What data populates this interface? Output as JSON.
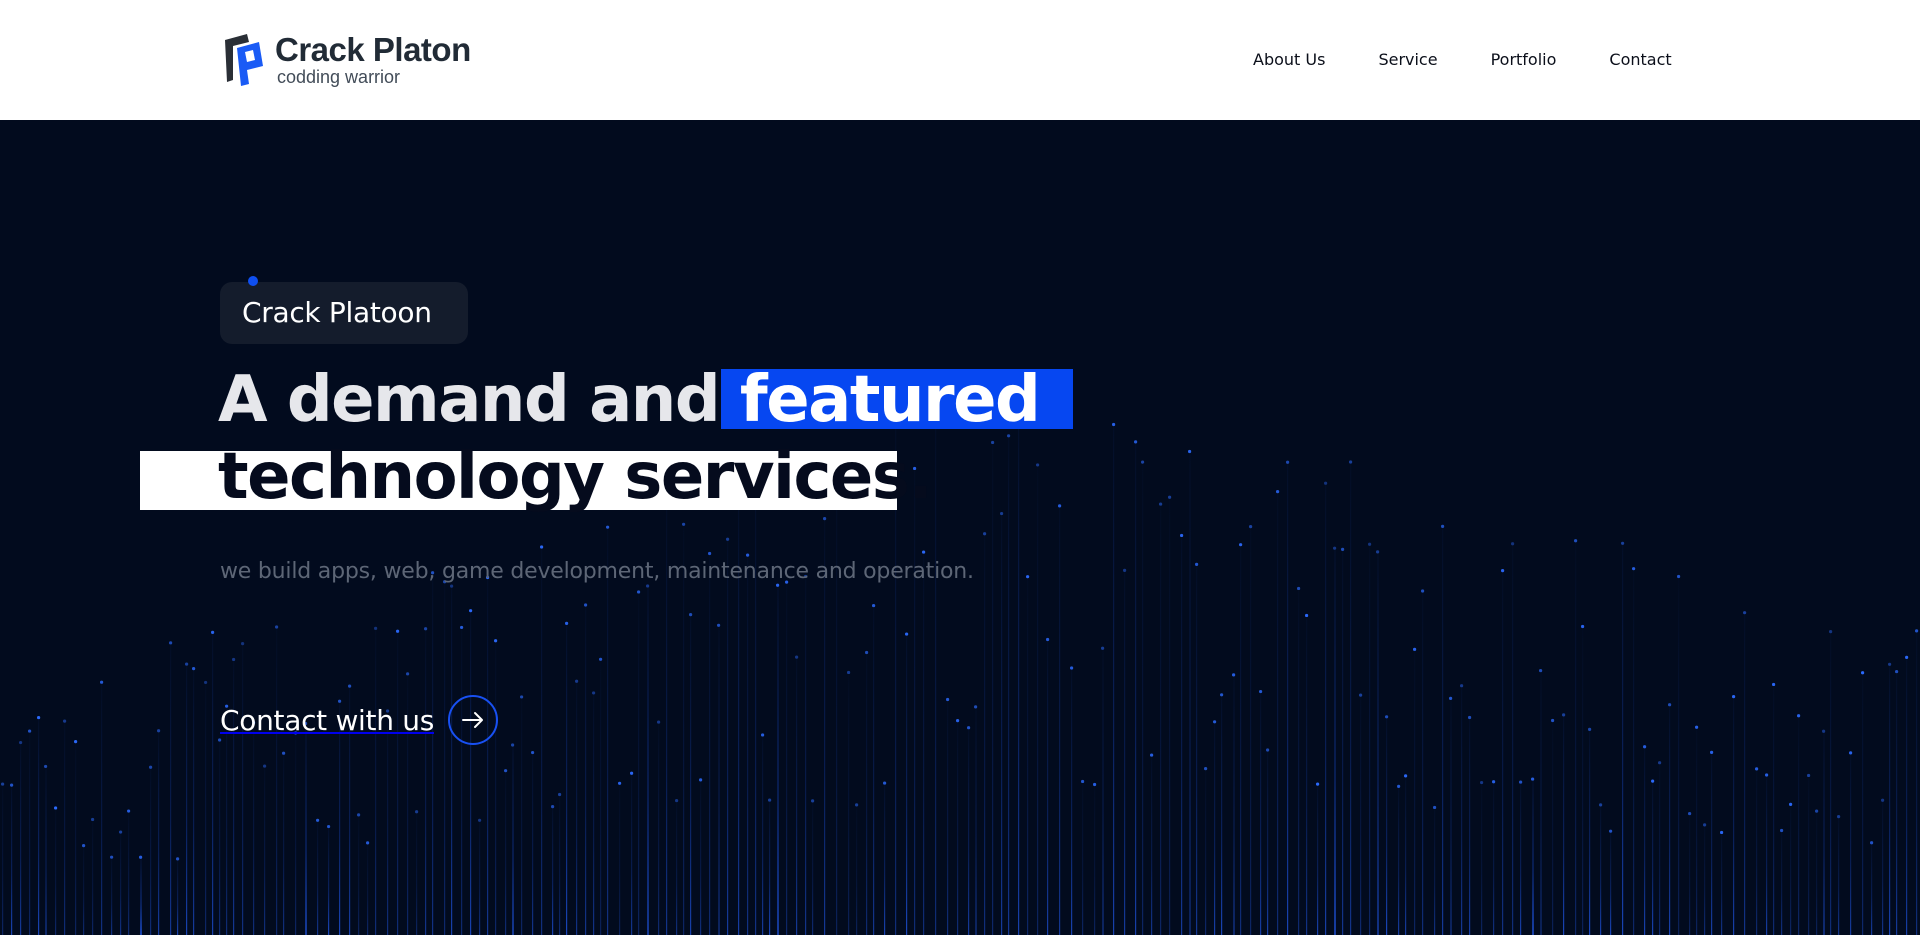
{
  "header": {
    "brand_name": "Crack Platon",
    "brand_tagline": "codding warrior",
    "nav": [
      {
        "label": "About Us"
      },
      {
        "label": "Service"
      },
      {
        "label": "Portfolio"
      },
      {
        "label": "Contact"
      }
    ]
  },
  "hero": {
    "badge": "Crack Platoon",
    "headline_line1_plain": "A demand and ",
    "headline_line1_highlight": "featured",
    "headline_line2": "technology services.",
    "subtitle": "we build apps, web, game development, maintenance and operation.",
    "cta_label": "Contact with us",
    "cta_icon": "arrow-right-icon"
  },
  "colors": {
    "hero_background": "#020b1e",
    "accent_blue": "#0647f1",
    "header_background": "#ffffff"
  }
}
